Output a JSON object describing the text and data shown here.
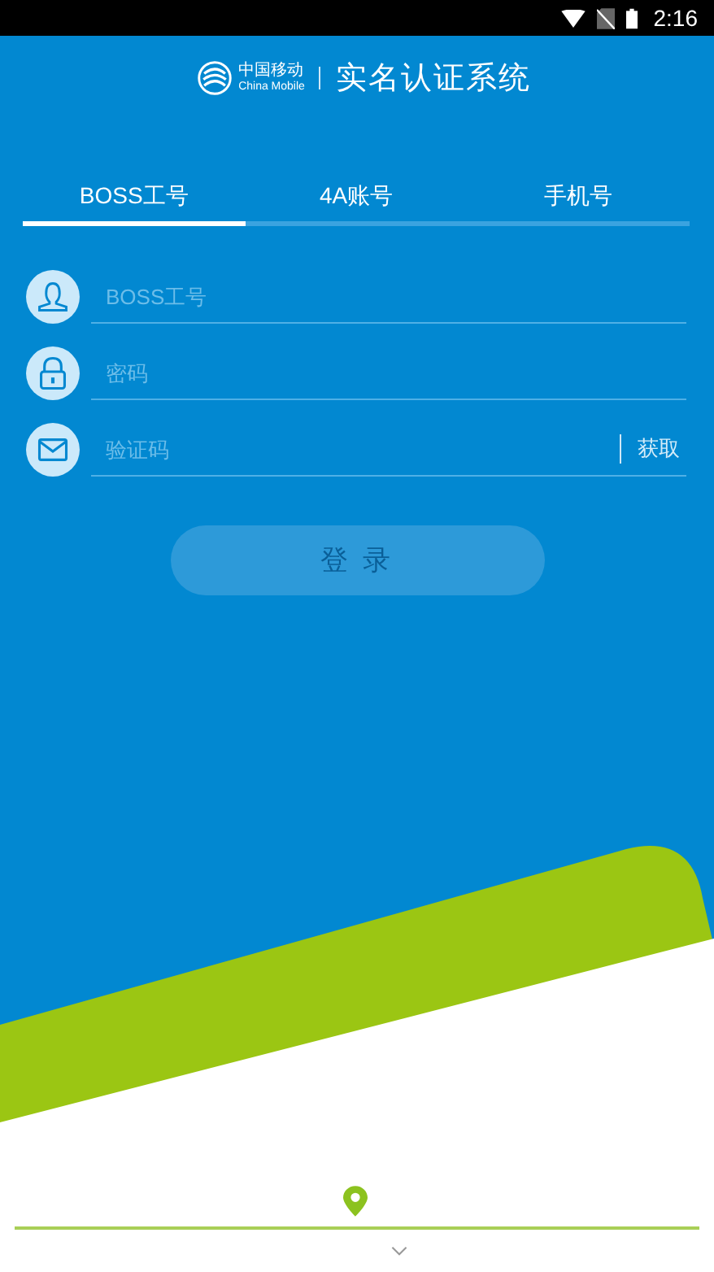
{
  "status_bar": {
    "time": "2:16"
  },
  "header": {
    "brand_cn": "中国移动",
    "brand_en": "China Mobile",
    "title": "实名认证系统"
  },
  "tabs": [
    {
      "label": "BOSS工号",
      "selected": true
    },
    {
      "label": "4A账号",
      "selected": false
    },
    {
      "label": "手机号",
      "selected": false
    }
  ],
  "fields": [
    {
      "kind": "user",
      "placeholder": "BOSS工号"
    },
    {
      "kind": "password",
      "placeholder": "密码"
    },
    {
      "kind": "code",
      "placeholder": "验证码",
      "action": "获取"
    }
  ],
  "login_button": {
    "label": "登 录",
    "disabled": true
  }
}
